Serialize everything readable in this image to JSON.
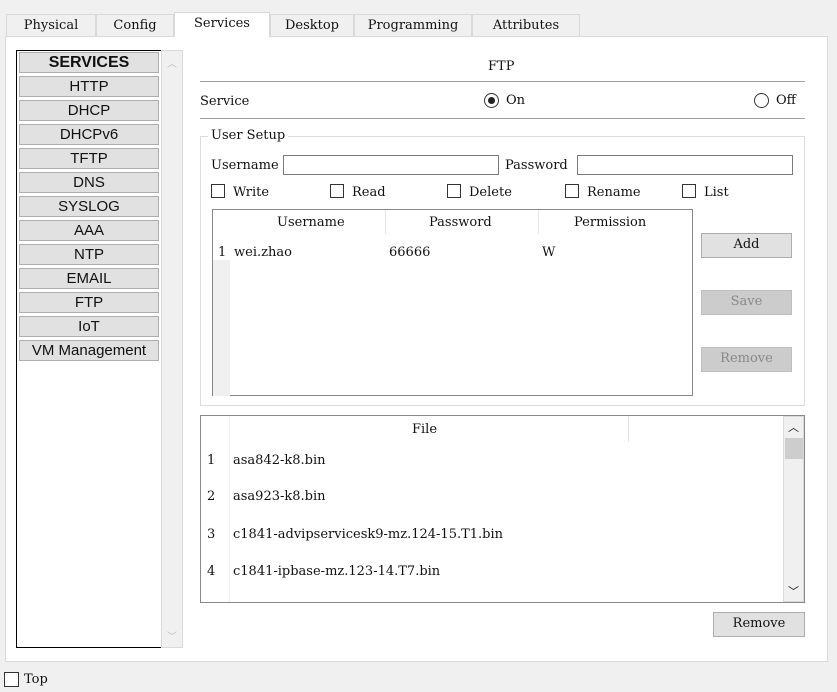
{
  "tabs": [
    "Physical",
    "Config",
    "Services",
    "Desktop",
    "Programming",
    "Attributes"
  ],
  "active_tab": "Services",
  "services": [
    "SERVICES",
    "HTTP",
    "DHCP",
    "DHCPv6",
    "TFTP",
    "DNS",
    "SYSLOG",
    "AAA",
    "NTP",
    "EMAIL",
    "FTP",
    "IoT",
    "VM Management"
  ],
  "ftp": {
    "title": "FTP",
    "service_label": "Service",
    "on_label": "On",
    "off_label": "Off",
    "service_state": "On",
    "user_setup": "User Setup",
    "username_label": "Username",
    "username_value": "",
    "password_label": "Password",
    "password_value": "",
    "permissions": [
      "Write",
      "Read",
      "Delete",
      "Rename",
      "List"
    ],
    "users_table": {
      "headers": [
        "Username",
        "Password",
        "Permission"
      ],
      "rows": [
        {
          "num": "1",
          "username": "wei.zhao",
          "password": "66666",
          "permission": "W"
        }
      ]
    },
    "add_label": "Add",
    "save_label": "Save",
    "remove_user_label": "Remove",
    "file_header": "File",
    "files": [
      {
        "num": "1",
        "name": "asa842-k8.bin"
      },
      {
        "num": "2",
        "name": "asa923-k8.bin"
      },
      {
        "num": "3",
        "name": "c1841-advipservicesk9-mz.124-15.T1.bin"
      },
      {
        "num": "4",
        "name": "c1841-ipbase-mz.123-14.T7.bin"
      }
    ],
    "remove_file_label": "Remove"
  },
  "top_label": "Top"
}
